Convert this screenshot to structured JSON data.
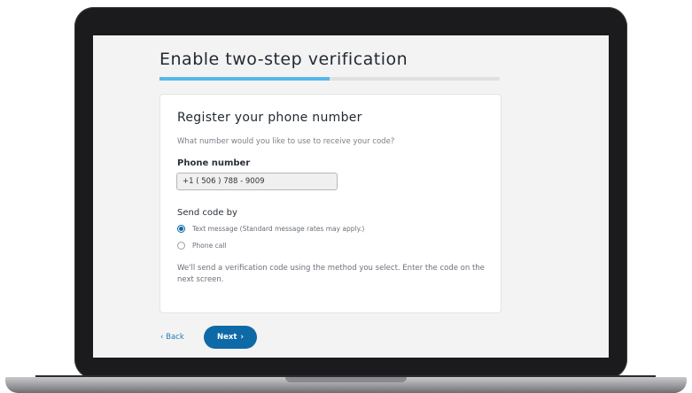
{
  "page": {
    "title": "Enable two-step verification",
    "progress_fraction": 0.5
  },
  "card": {
    "title": "Register your phone number",
    "subtitle": "What number would you like to use to receive your code?",
    "phone_label": "Phone number",
    "phone_value": "+1 ( 506 ) 788 - 9009",
    "send_label": "Send code by",
    "options": [
      {
        "label": "Text message (Standard message rates may apply.)",
        "selected": true
      },
      {
        "label": "Phone call",
        "selected": false
      }
    ],
    "help_text": "We'll send a verification code using the method you select. Enter the code on the next screen."
  },
  "actions": {
    "back_arrow": "‹",
    "back_label": "Back",
    "next_label": "Next",
    "next_arrow": "›"
  },
  "colors": {
    "accent": "#0e6aa7",
    "progress": "#56b7ea"
  }
}
